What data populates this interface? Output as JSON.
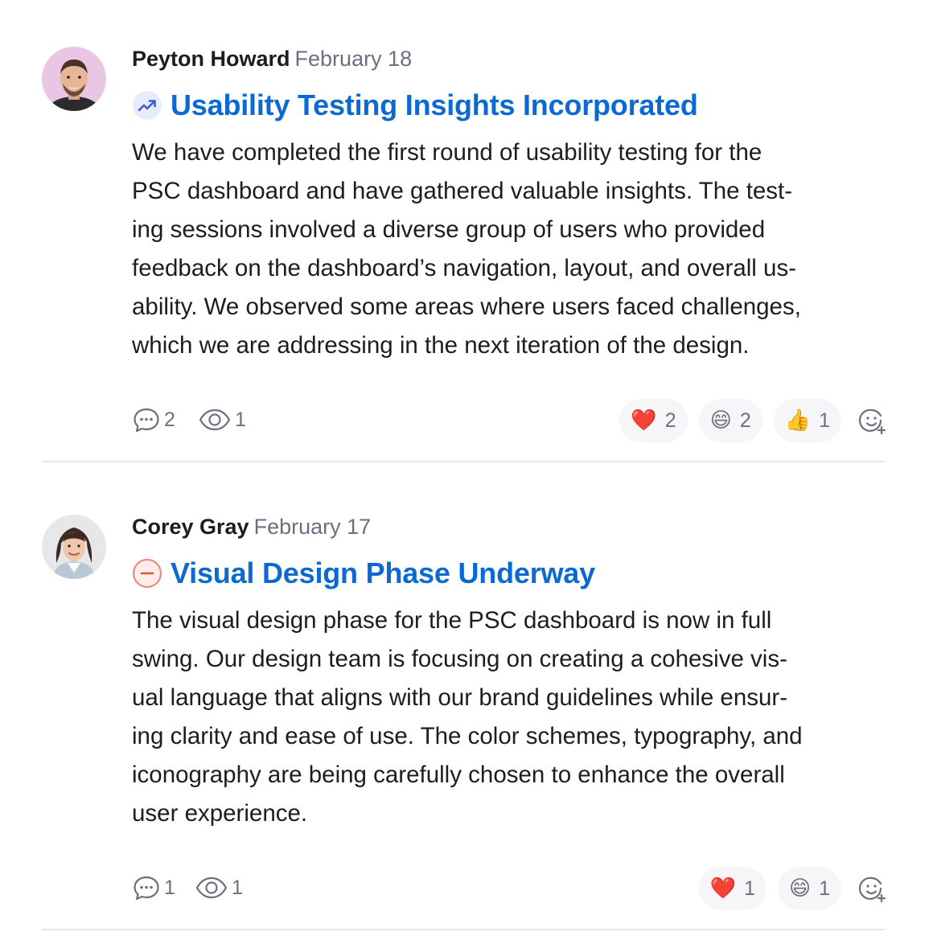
{
  "posts": [
    {
      "author": "Peyton Howard",
      "date": "February 18",
      "status_icon": "trending-up-icon",
      "title": "Usability Testing Insights Incorporated",
      "body_lines": [
        "We have completed the first round of usability testing for the",
        "PSC dashboard and have gathered valuable insights. The test-",
        "ing sessions involved a diverse group of users who provided",
        "feedback on the dashboard’s navigation, layout, and overall us-",
        "ability. We observed some areas where users faced challenges,",
        "which we are addressing in the next iteration of the design."
      ],
      "comment_count": "2",
      "view_count": "1",
      "reactions": [
        {
          "emoji": "❤️",
          "name": "heart",
          "count": "2"
        },
        {
          "emoji": "😄",
          "name": "grin",
          "count": "2"
        },
        {
          "emoji": "👍",
          "name": "thumbs-up",
          "count": "1"
        }
      ]
    },
    {
      "author": "Corey Gray",
      "date": "February 17",
      "status_icon": "minus-circle-icon",
      "title": "Visual Design Phase Underway",
      "body_lines": [
        "The visual design phase for the PSC dashboard is now in full",
        "swing. Our design team is focusing on creating a cohesive vis-",
        "ual language that aligns with our brand guidelines while ensur-",
        "ing clarity and ease of use. The color schemes, typography, and",
        "iconography are being carefully chosen to enhance the overall",
        "user experience."
      ],
      "comment_count": "1",
      "view_count": "1",
      "reactions": [
        {
          "emoji": "❤️",
          "name": "heart",
          "count": "1"
        },
        {
          "emoji": "😄",
          "name": "grin",
          "count": "1"
        }
      ]
    }
  ],
  "colors": {
    "title_link": "#0b6ad1",
    "meta_gray": "#6e6e80",
    "divider": "#e6e6ea",
    "reaction_bg": "#f6f6f8"
  }
}
